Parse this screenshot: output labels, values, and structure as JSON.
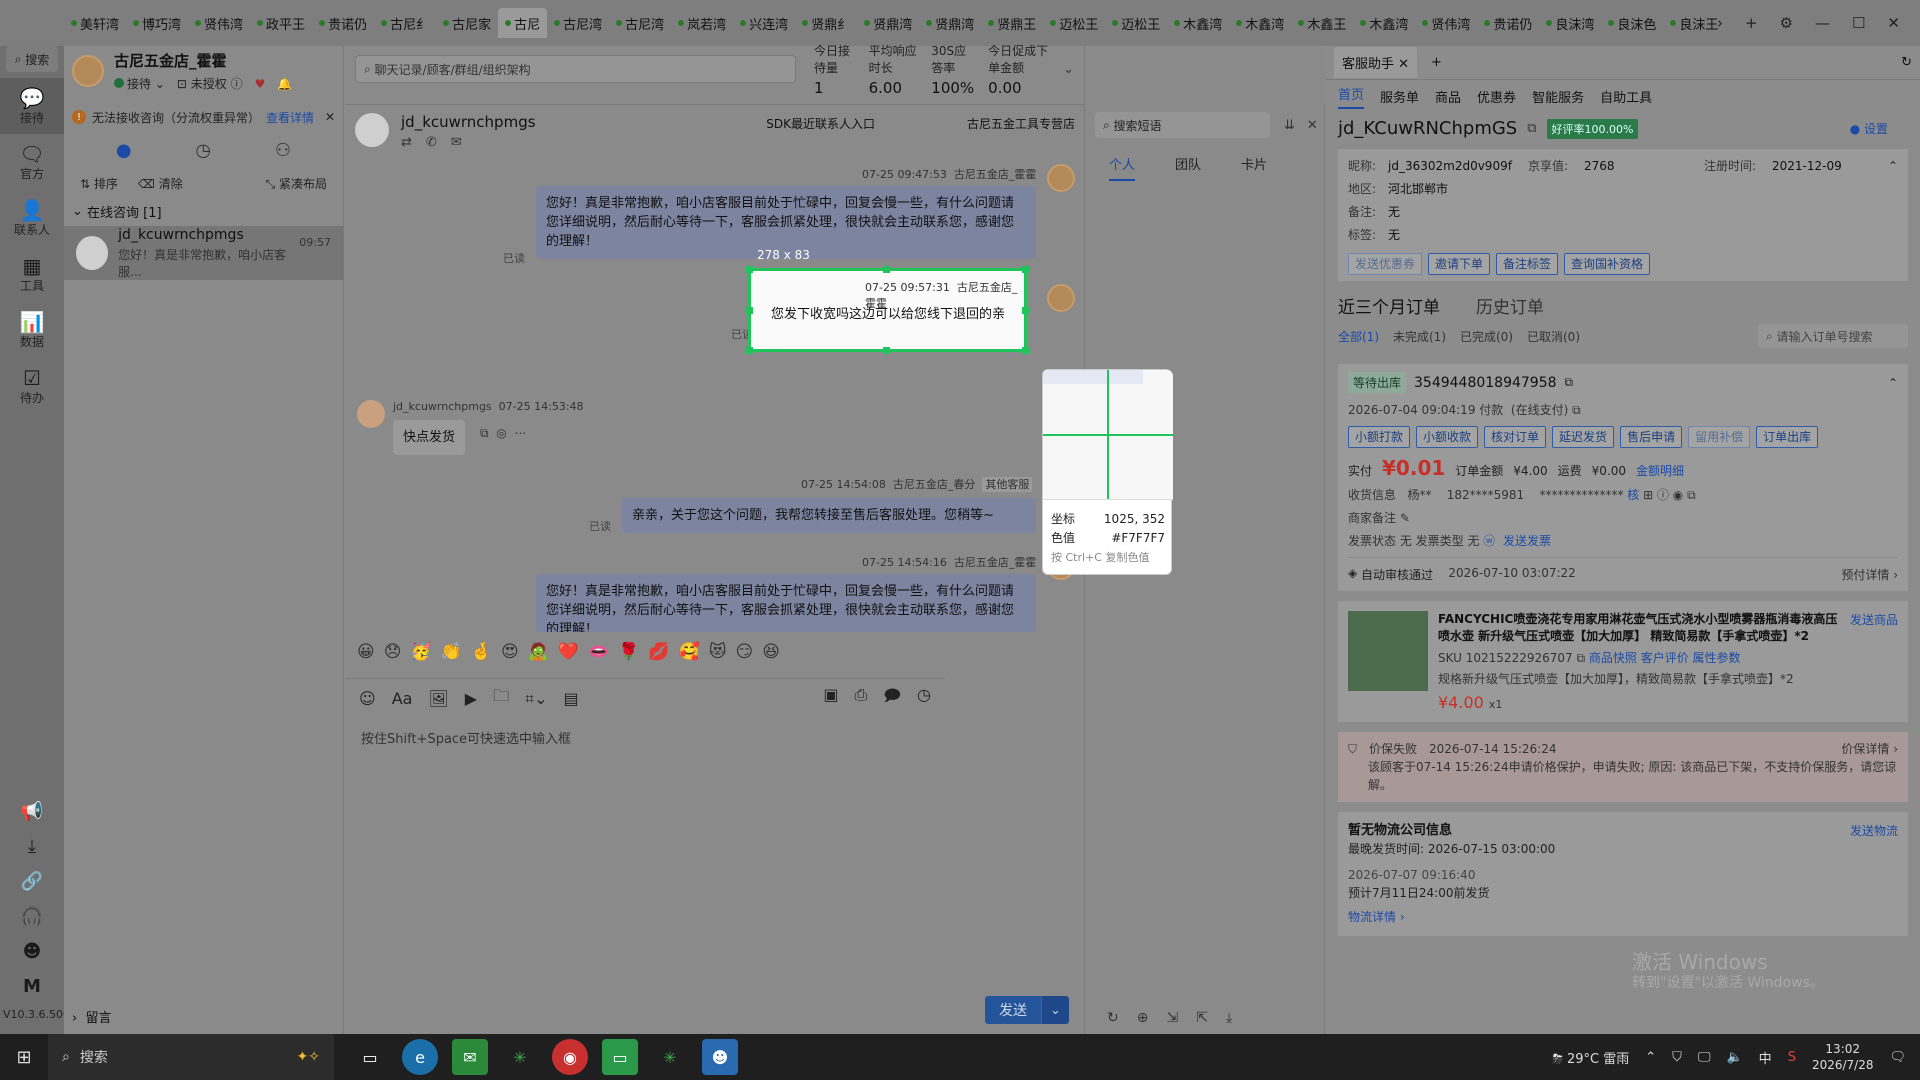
{
  "tabs": [
    "美轩湾",
    "博巧湾",
    "贤伟湾",
    "政平王",
    "贵诺仍",
    "古尼纟",
    "古尼家",
    "古尼",
    "古尼湾",
    "古尼湾",
    "岚若湾",
    "兴连湾",
    "贤鼎纟",
    "贤鼎湾",
    "贤鼎湾",
    "贤鼎王",
    "迈松王",
    "迈松王",
    "木鑫湾",
    "木鑫湾",
    "木鑫王",
    "木鑫湾",
    "贤伟湾",
    "贵诺仍",
    "良沫湾",
    "良沫色",
    "良沫王"
  ],
  "active_tab_index": 7,
  "window_controls": {
    "more": "›",
    "add": "+",
    "settings": "⚙",
    "minimize": "—",
    "maximize": "☐",
    "close": "✕"
  },
  "leftnav": {
    "search": "搜索",
    "items": [
      {
        "label": "接待",
        "icon": "chat-icon"
      },
      {
        "label": "官方",
        "icon": "message-icon"
      },
      {
        "label": "联系人",
        "icon": "contact-icon"
      },
      {
        "label": "工具",
        "icon": "tools-icon"
      },
      {
        "label": "数据",
        "icon": "chart-icon"
      },
      {
        "label": "待办",
        "icon": "todo-icon"
      }
    ],
    "version": "V10.3.6.500"
  },
  "session": {
    "shop_name": "古尼五金店_霍霍",
    "status": "接待",
    "auth": "未授权",
    "warning": "无法接收咨询（分流权重异常）",
    "warning_link": "查看详情",
    "tool_sort": "排序",
    "tool_clear": "清除",
    "tool_layout": "紧凑布局",
    "group_title": "在线咨询 [1]",
    "item_name": "jd_kcuwrnchpmgs",
    "item_time": "09:57",
    "item_preview": "您好！真是非常抱歉，咱小店客服...",
    "leave_msg": "留言"
  },
  "chat": {
    "search_placeholder": "聊天记录/顾客/群组/组织架构",
    "stats": [
      {
        "label": "今日接待量",
        "value": "1"
      },
      {
        "label": "平均响应时长",
        "value": "6.00"
      },
      {
        "label": "30S应答率",
        "value": "100%"
      },
      {
        "label": "今日促成下单金额",
        "value": "0.00"
      }
    ],
    "customer": "jd_kcuwrnchpmgs",
    "sdk_entry": "SDK最近联系人入口",
    "shop_tag": "古尼五金工具专营店",
    "messages": [
      {
        "time": "07-25 09:47:53",
        "sender": "古尼五金店_霍霍",
        "text": "您好！真是非常抱歉，咱小店客服目前处于忙碌中，回复会慢一些，有什么问题请您详细说明，然后耐心等待一下，客服会抓紧处理，很快就会主动联系您，感谢您的理解！",
        "read": "已读"
      },
      {
        "time": "07-25 09:57:31",
        "sender": "古尼五金店_霍霍",
        "text": "您发下收宽吗这边可以给您线下退回的亲",
        "read": "已读"
      },
      {
        "customer": "jd_kcuwrnchpmgs",
        "time": "07-25 14:53:48",
        "text": "快点发货"
      },
      {
        "time": "07-25 14:54:08",
        "sender": "古尼五金店_春分",
        "tag": "其他客服",
        "text": "亲亲，关于您这个问题，我帮您转接至售后客服处理。您稍等~",
        "read": "已读"
      },
      {
        "time": "07-25 14:54:16",
        "sender": "古尼五金店_霍霍",
        "text": "您好！真是非常抱歉，咱小店客服目前处于忙碌中，回复会慢一些，有什么问题请您详细说明，然后耐心等待一下，客服会抓紧处理，很快就会主动联系您，感谢您的理解！"
      }
    ],
    "emojis": [
      "😀",
      "😞",
      "🥳",
      "👏",
      "🤞",
      "😍",
      "🧟",
      "❤️",
      "👄",
      "🌹",
      "💋",
      "🥰",
      "😻",
      "😏",
      "😆"
    ],
    "input_placeholder": "按住Shift+Space可快速选中输入框",
    "send": "发送"
  },
  "quick": {
    "search_placeholder": "搜索短语",
    "tabs": [
      "个人",
      "团队",
      "卡片"
    ]
  },
  "right": {
    "tab_title": "客服助手",
    "nav": [
      "首页",
      "服务单",
      "商品",
      "优惠券",
      "智能服务",
      "自助工具"
    ],
    "user_id": "jd_KCuwRNChpmGS",
    "badge": "好评率100.00%",
    "settings": "设置",
    "info": {
      "nick_k": "昵称:",
      "nick_v": "jd_36302m2d0v909f",
      "jx_k": "京享值:",
      "jx_v": "2768",
      "reg_k": "注册时间:",
      "reg_v": "2021-12-09",
      "area_k": "地区:",
      "area_v": "河北邯郸市",
      "note_k": "备注:",
      "note_v": "无",
      "tag_k": "标签:",
      "tag_v": "无"
    },
    "info_buttons": [
      "发送优惠券",
      "邀请下单",
      "备注标签",
      "查询国补资格"
    ],
    "order_tabs": [
      "近三个月订单",
      "历史订单"
    ],
    "order_filters": [
      "全部(1)",
      "未完成(1)",
      "已完成(0)",
      "已取消(0)"
    ],
    "order_search": "请输入订单号搜索",
    "order": {
      "status": "等待出库",
      "id": "3549448018947958",
      "pay_time": "2026-07-04 09:04:19 付款",
      "pay_type": "(在线支付)",
      "buttons": [
        "小额打款",
        "小额收款",
        "核对订单",
        "延迟发货",
        "售后申请",
        "留用补偿",
        "订单出库"
      ],
      "paid_label": "实付",
      "paid": "¥0.01",
      "amount_label": "订单金额",
      "amount": "¥4.00",
      "ship_label": "运费",
      "ship": "¥0.00",
      "detail": "金额明细",
      "recv_label": "收货信息",
      "recv_name": "杨**",
      "recv_phone": "182****5981",
      "recv_addr": "**************",
      "merchant_note": "商家备注",
      "invoice": "发票状态  无    发票类型  无",
      "invoice_link": "发送发票",
      "audit": "自动审核通过",
      "audit_time": "2026-07-10 03:07:22",
      "audit_link": "预付详情 ›"
    },
    "product": {
      "title": "FANCYCHIC喷壶浇花专用家用淋花壶气压式浇水小型喷雾器瓶消毒液高压喷水壶 新升级气压式喷壶【加大加厚】 精致简易款【手拿式喷壶】*2",
      "send": "发送商品",
      "sku": "SKU 10215222926707",
      "links": [
        "商品快照",
        "客户评价",
        "属性参数"
      ],
      "spec": "规格新升级气压式喷壶【加大加厚】，精致简易款【手拿式喷壶】*2",
      "price": "¥4.00",
      "qty": "x1"
    },
    "price_protect": {
      "label": "价保失败",
      "time": "2026-07-14 15:26:24",
      "link": "价保详情 ›",
      "text": "该顾客于07-14 15:26:24申请价格保护，申请失败; 原因: 该商品已下架，不支持价保服务，请您谅解。"
    },
    "logistics": {
      "title": "暂无物流公司信息",
      "send": "发送物流",
      "latest": "最晚发货时间: 2026-07-15 03:00:00",
      "time": "2026-07-07 09:16:40",
      "eta": "预计7月11日24:00前发货",
      "detail": "物流详情 ›"
    }
  },
  "overlay": {
    "size": "278 x 83",
    "coord_label": "坐标",
    "coord": "1025, 352",
    "color_label": "色值",
    "color": "#F7F7F7",
    "hint": "按 Ctrl+C 复制色值"
  },
  "watermark": {
    "line1": "激活 Windows",
    "line2": "转到\"设置\"以激活 Windows。"
  },
  "taskbar": {
    "search": "搜索",
    "weather": "29°C 雷雨",
    "time": "13:02",
    "date": "2026/7/28",
    "ime": "中"
  },
  "colors": {
    "accent": "#1C4AA8",
    "price": "#C7302A",
    "selection": "#1FC55A"
  }
}
